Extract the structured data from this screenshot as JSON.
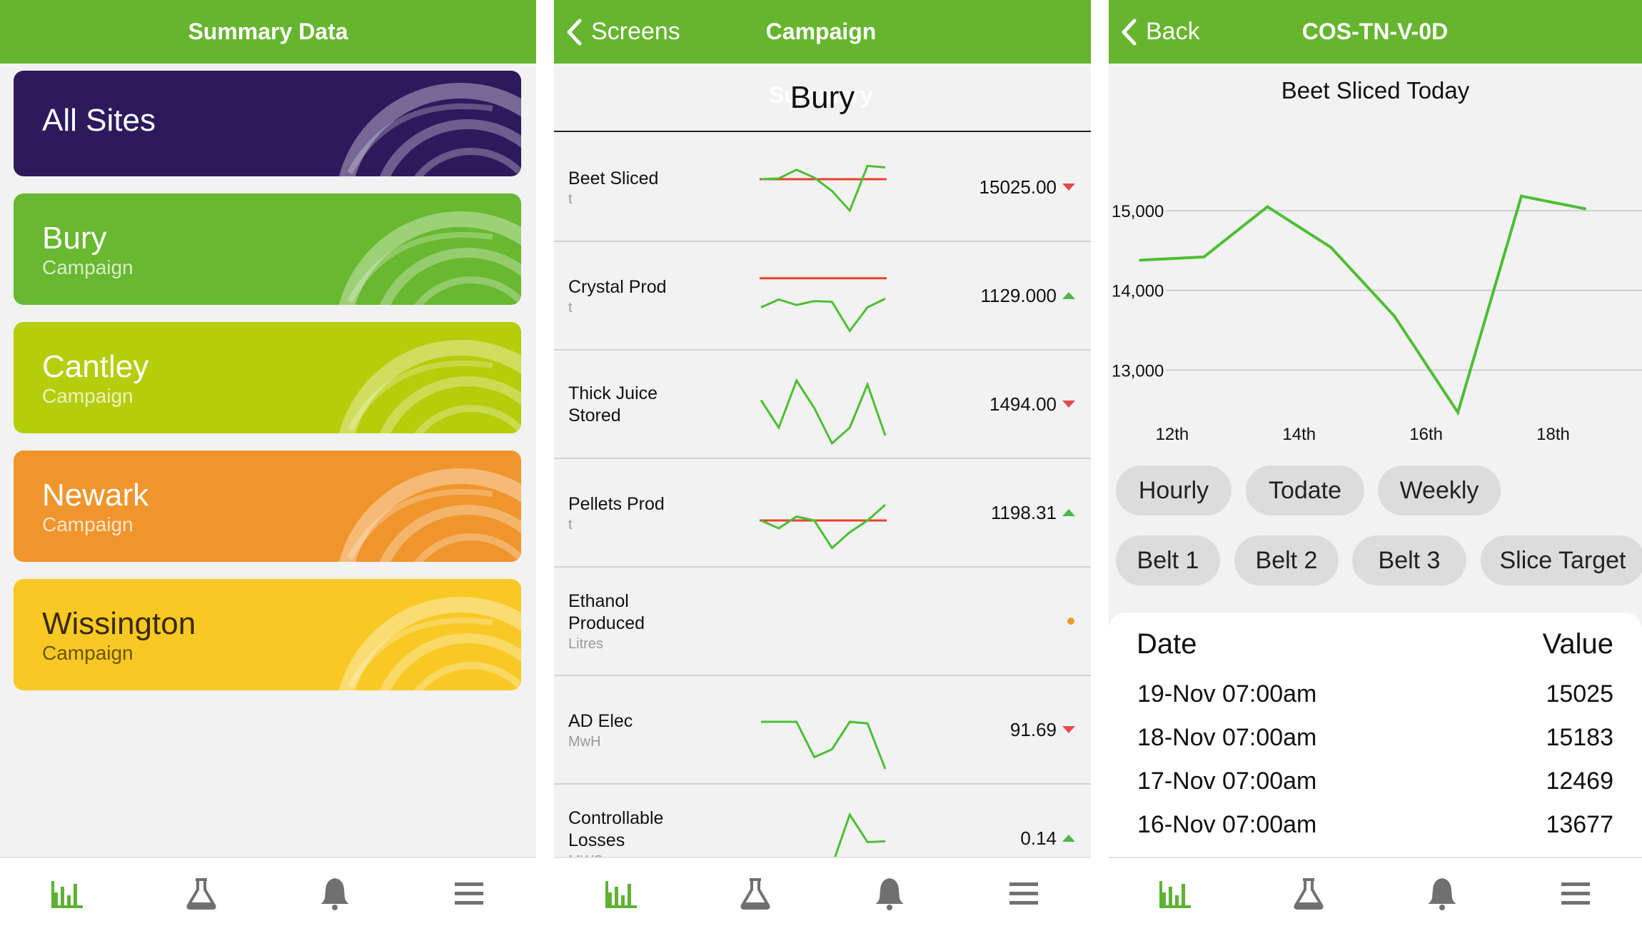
{
  "screen1": {
    "title": "Summary Data",
    "cards": [
      {
        "title": "All Sites",
        "subtitle": "",
        "color": "#2d1a5d"
      },
      {
        "title": "Bury",
        "subtitle": "Campaign",
        "color": "#68b830"
      },
      {
        "title": "Cantley",
        "subtitle": "Campaign",
        "color": "#b5cd0a"
      },
      {
        "title": "Newark",
        "subtitle": "Campaign",
        "color": "#f0952c"
      },
      {
        "title": "Wissington",
        "subtitle": "Campaign",
        "color": "#f8c925"
      }
    ]
  },
  "screen2": {
    "back_label": "Screens",
    "title": "Campaign Summary",
    "site": "Bury",
    "rows": [
      {
        "name": "Beet Sliced",
        "unit": "t",
        "value": "15025.00",
        "trend": "down",
        "spark": [
          0.6,
          0.61,
          0.72,
          0.62,
          0.45,
          0.2,
          0.77,
          0.75
        ],
        "target": 0.6
      },
      {
        "name": "Crystal Prod",
        "unit": "t",
        "value": "1129.000",
        "trend": "up",
        "spark": [
          0.35,
          0.45,
          0.38,
          0.43,
          0.42,
          0.05,
          0.35,
          0.46
        ],
        "target": 0.72
      },
      {
        "name": "Thick Juice Stored",
        "unit": "",
        "value": "1494.00",
        "trend": "down",
        "spark": [
          0.55,
          0.2,
          0.8,
          0.45,
          0.0,
          0.2,
          0.75,
          0.1
        ],
        "target": null
      },
      {
        "name": "Pellets Prod",
        "unit": "t",
        "value": "1198.31",
        "trend": "up",
        "spark": [
          0.4,
          0.3,
          0.45,
          0.4,
          0.05,
          0.25,
          0.4,
          0.6
        ],
        "target": 0.4
      },
      {
        "name": "Ethanol Produced",
        "unit": "Litres",
        "value": "",
        "trend": "none",
        "spark": [],
        "target": null
      },
      {
        "name": "AD Elec",
        "unit": "MwH",
        "value": "91.69",
        "trend": "down",
        "spark": [
          0.6,
          0.6,
          0.6,
          0.15,
          0.25,
          0.6,
          0.58,
          0.0
        ],
        "target": null
      },
      {
        "name": "Controllable Losses",
        "unit": "MWS",
        "value": "0.14",
        "trend": "up",
        "spark": [
          0.1,
          0.12,
          0.05,
          0.1,
          0.15,
          0.8,
          0.45,
          0.46
        ],
        "target": null
      }
    ]
  },
  "screen3": {
    "back_label": "Back",
    "title": "COS-TN-V-0D",
    "chart_title": "Beet Sliced Today",
    "buttons_row1": [
      "Hourly",
      "Todate",
      "Weekly"
    ],
    "buttons_row2": [
      "Belt 1",
      "Belt 2",
      "Belt 3",
      "Slice Target"
    ],
    "table_headers": {
      "date": "Date",
      "value": "Value"
    },
    "table_rows": [
      {
        "date": "19-Nov 07:00am",
        "value": "15025"
      },
      {
        "date": "18-Nov 07:00am",
        "value": "15183"
      },
      {
        "date": "17-Nov 07:00am",
        "value": "12469"
      },
      {
        "date": "16-Nov 07:00am",
        "value": "13677"
      }
    ]
  },
  "chart_data": {
    "type": "line",
    "title": "Beet Sliced Today",
    "x": [
      11.5,
      12.5,
      13.5,
      14.5,
      15.5,
      16.5,
      17.5,
      18.5
    ],
    "x_ticks": [
      {
        "x": 12,
        "label": "12th"
      },
      {
        "x": 14,
        "label": "14th"
      },
      {
        "x": 16,
        "label": "16th"
      },
      {
        "x": 18,
        "label": "18th"
      }
    ],
    "y_ticks": [
      {
        "y": 13000,
        "label": "13,000"
      },
      {
        "y": 14000,
        "label": "14,000"
      },
      {
        "y": 15000,
        "label": "15,000"
      }
    ],
    "series": [
      {
        "values": [
          14380,
          14420,
          15050,
          14540,
          13677,
          12469,
          15183,
          15025
        ]
      }
    ],
    "xlim": [
      11,
      19.4
    ],
    "ylim": [
      12000,
      16300
    ],
    "grid": true
  },
  "tabbar": {
    "icons": [
      "bar-chart-icon",
      "flask-icon",
      "bell-icon",
      "menu-icon"
    ],
    "active_color": "#5db233",
    "inactive_color": "#707070"
  },
  "colors": {
    "brand_green": "#66b52f",
    "line_green": "#4cbf33",
    "target_red": "#e8412b"
  }
}
